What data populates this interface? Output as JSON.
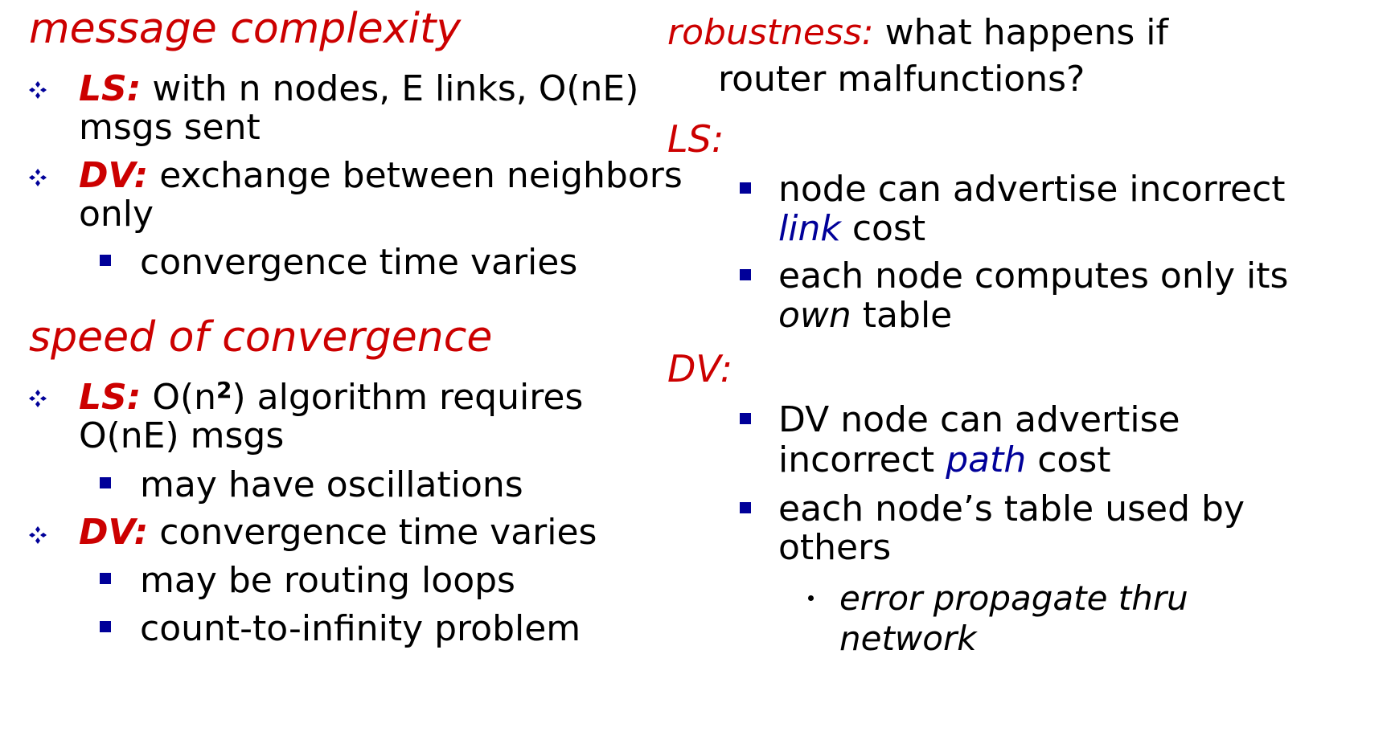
{
  "left": {
    "message_complexity": {
      "heading": "message complexity",
      "ls_label": "LS:",
      "ls_line1": "with n nodes, E links, O(nE)",
      "ls_line2": "msgs sent",
      "dv_label": "DV:",
      "dv_line1": "exchange between neighbors",
      "dv_line2": "only",
      "dv_sub1": "convergence time varies"
    },
    "speed_of_convergence": {
      "heading": "speed of convergence",
      "ls_label": "LS:",
      "ls_line1_pre": "O(n",
      "ls_line1_sup": "2",
      "ls_line1_post": ") algorithm requires",
      "ls_line2": "O(nE) msgs",
      "ls_sub1": "may have oscillations",
      "dv_label": "DV:",
      "dv_line1": "convergence time varies",
      "dv_sub1": "may be routing loops",
      "dv_sub2": "count-to-infinity problem"
    }
  },
  "right": {
    "robustness": {
      "label": "robustness:",
      "line1": "what happens if",
      "line2": "router malfunctions?"
    },
    "ls": {
      "label": "LS:",
      "b1_line1": "node can advertise incorrect",
      "b1_line2_ital": "link",
      "b1_line2_rest": "cost",
      "b2_line1": "each node computes only its",
      "b2_line2_ital": "own",
      "b2_line2_rest": "table"
    },
    "dv": {
      "label": "DV:",
      "b1_line1": "DV node can advertise",
      "b1_line2_pre": "incorrect",
      "b1_line2_ital": "path",
      "b1_line2_rest": "cost",
      "b2_line1": "each node’s table used by",
      "b2_line2": "others",
      "sub_line1": "error propagate thru",
      "sub_line2": "network"
    }
  },
  "colors": {
    "heading_red": "#cc0000",
    "bullet_blue": "#000099"
  },
  "icons": {
    "top_level_bullet": "four-diamond-bullet",
    "sub_bullet": "square-bullet",
    "third_bullet": "dot-bullet"
  }
}
